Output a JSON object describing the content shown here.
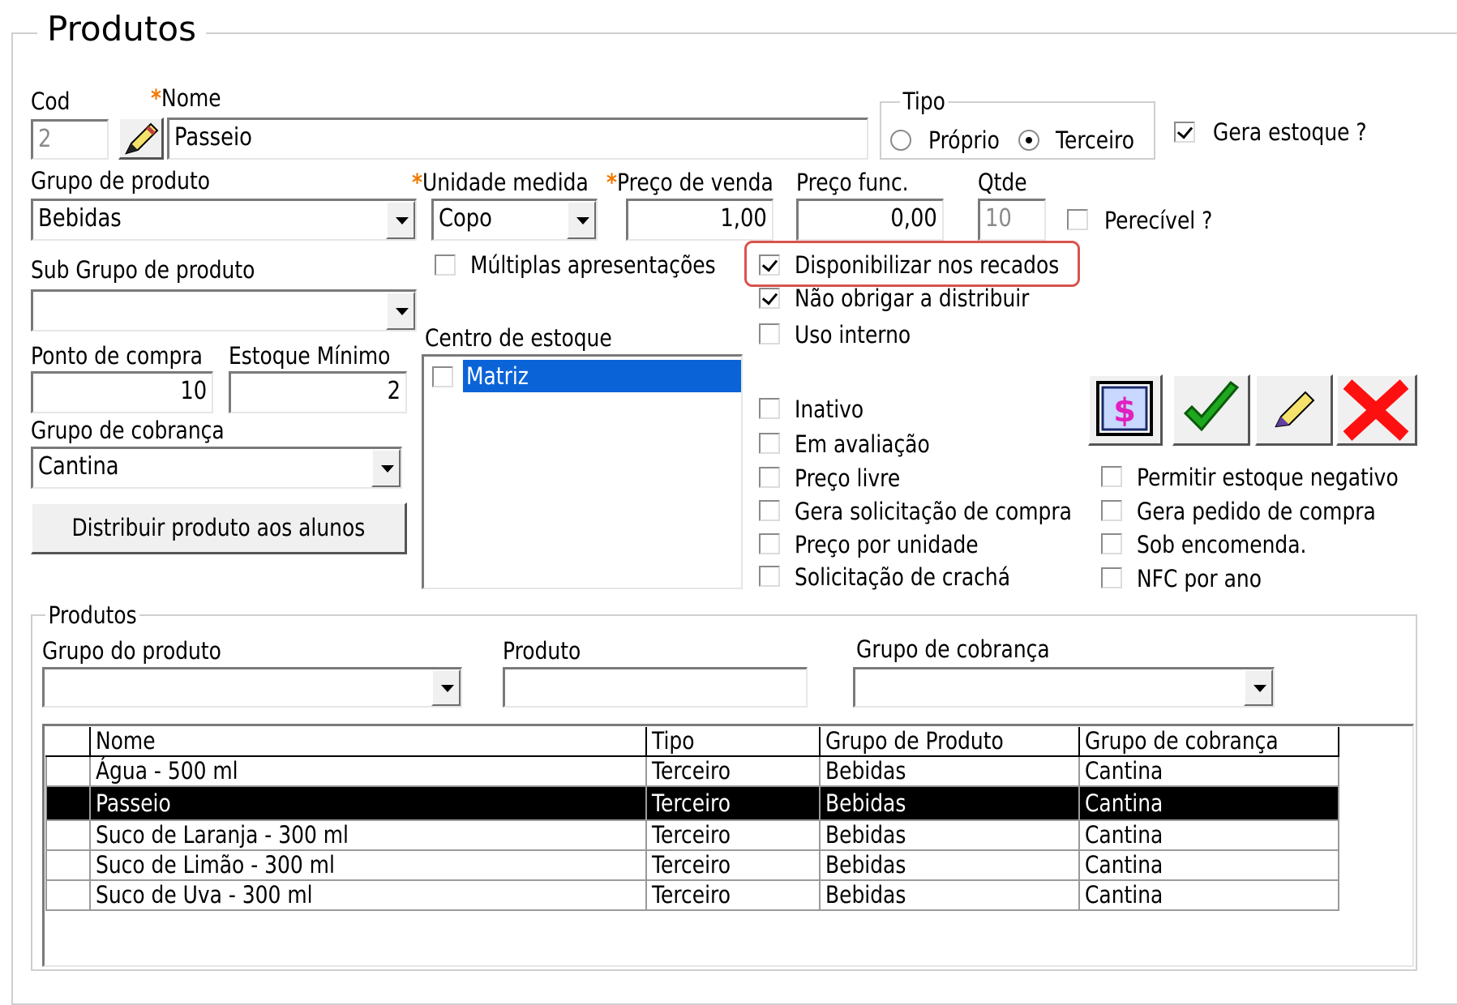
{
  "form": {
    "title": "Produtos",
    "cod": {
      "label": "Cod",
      "value": "2"
    },
    "nome": {
      "label": "Nome",
      "required_mark": "*",
      "value": "Passeio"
    },
    "tipo": {
      "label": "Tipo",
      "options": [
        "Próprio",
        "Terceiro"
      ],
      "selected": "Terceiro"
    },
    "gera_estoque": {
      "label": "Gera estoque ?",
      "checked": true
    },
    "grupo_produto": {
      "label": "Grupo de produto",
      "value": "Bebidas"
    },
    "unidade_medida": {
      "label": "Unidade medida",
      "required_mark": "*",
      "value": "Copo"
    },
    "preco_venda": {
      "label": "Preço de venda",
      "required_mark": "*",
      "value": "1,00"
    },
    "preco_func": {
      "label": "Preço func.",
      "value": "0,00"
    },
    "qtde": {
      "label": "Qtde",
      "value": "10"
    },
    "perecivel": {
      "label": "Perecível ?",
      "checked": false
    },
    "multiplas": {
      "label": "Múltiplas apresentações",
      "checked": false
    },
    "sub_grupo": {
      "label": "Sub Grupo de produto",
      "value": ""
    },
    "ponto_compra": {
      "label": "Ponto de compra",
      "value": "10"
    },
    "estoque_minimo": {
      "label": "Estoque Mínimo",
      "value": "2"
    },
    "grupo_cobranca": {
      "label": "Grupo de cobrança",
      "value": "Cantina"
    },
    "distribuir_btn": "Distribuir produto aos alunos",
    "centro_estoque": {
      "label": "Centro de estoque",
      "items": [
        "Matriz"
      ]
    },
    "checks_mid": [
      {
        "label": "Disponibilizar nos recados",
        "checked": true
      },
      {
        "label": "Não obrigar a distribuir",
        "checked": true
      },
      {
        "label": "Uso interno",
        "checked": false
      },
      {
        "label": "Inativo",
        "checked": false
      },
      {
        "label": "Em avaliação",
        "checked": false
      },
      {
        "label": "Preço livre",
        "checked": false
      },
      {
        "label": "Gera solicitação de compra",
        "checked": false
      },
      {
        "label": "Preço por unidade",
        "checked": false
      },
      {
        "label": "Solicitação de crachá",
        "checked": false
      }
    ],
    "checks_right": [
      {
        "label": "Permitir estoque negativo",
        "checked": false
      },
      {
        "label": "Gera pedido de compra",
        "checked": false
      },
      {
        "label": "Sob encomenda.",
        "checked": false
      },
      {
        "label": "NFC por ano",
        "checked": false
      }
    ],
    "highlight_color": "#d9534f"
  },
  "filter": {
    "title": "Produtos",
    "grupo_produto": {
      "label": "Grupo do produto",
      "value": ""
    },
    "produto": {
      "label": "Produto",
      "value": ""
    },
    "grupo_cobranca": {
      "label": "Grupo de cobrança",
      "value": ""
    }
  },
  "grid": {
    "columns": [
      "Nome",
      "Tipo",
      "Grupo de Produto",
      "Grupo de cobrança"
    ],
    "rows": [
      [
        "Água - 500 ml",
        "Terceiro",
        "Bebidas",
        "Cantina"
      ],
      [
        "Passeio",
        "Terceiro",
        "Bebidas",
        "Cantina"
      ],
      [
        "Suco de Laranja - 300 ml",
        "Terceiro",
        "Bebidas",
        "Cantina"
      ],
      [
        "Suco de Limão - 300 ml",
        "Terceiro",
        "Bebidas",
        "Cantina"
      ],
      [
        "Suco de Uva - 300 ml",
        "Terceiro",
        "Bebidas",
        "Cantina"
      ]
    ],
    "selected_row": 1
  }
}
